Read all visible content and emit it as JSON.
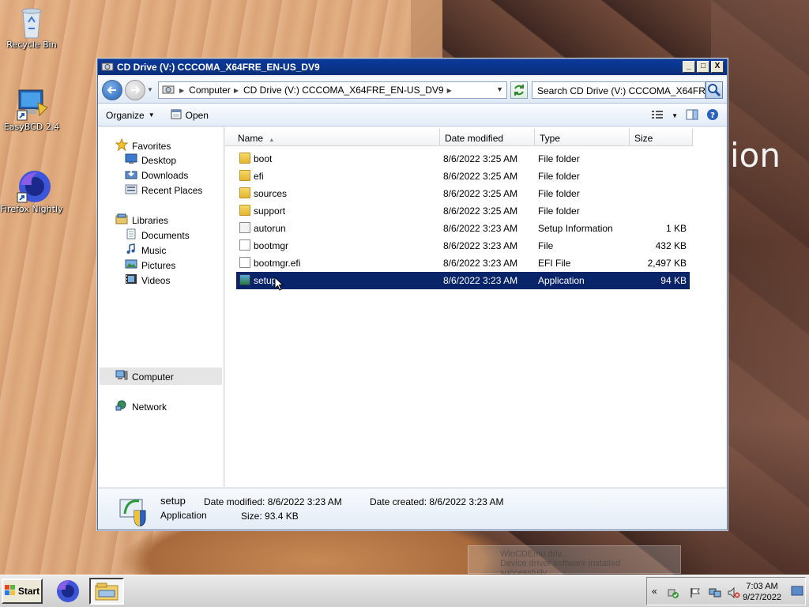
{
  "desktop": {
    "icons": [
      {
        "label": "Recycle Bin",
        "icon": "recycle-bin-icon"
      },
      {
        "label": "EasyBCD 2.4",
        "icon": "easybcd-icon"
      },
      {
        "label": "Firefox Nightly",
        "icon": "firefox-nightly-icon"
      }
    ],
    "wallpaper_text": "ion"
  },
  "window": {
    "title": "CD Drive (V:) CCCOMA_X64FRE_EN-US_DV9",
    "buttons": {
      "minimize": "_",
      "maximize": "□",
      "close": "X"
    },
    "address": {
      "crumbs": [
        "Computer",
        "CD Drive (V:) CCCOMA_X64FRE_EN-US_DV9"
      ]
    },
    "search_placeholder": "Search CD Drive (V:) CCCOMA_X64FR...",
    "commands": {
      "organize": "Organize",
      "open": "Open"
    },
    "nav": {
      "favorites": "Favorites",
      "desktop": "Desktop",
      "downloads": "Downloads",
      "recent": "Recent Places",
      "libraries": "Libraries",
      "documents": "Documents",
      "music": "Music",
      "pictures": "Pictures",
      "videos": "Videos",
      "computer": "Computer",
      "network": "Network"
    },
    "columns": {
      "name": "Name",
      "date": "Date modified",
      "type": "Type",
      "size": "Size"
    },
    "files": [
      {
        "name": "boot",
        "date": "8/6/2022 3:25 AM",
        "type": "File folder",
        "size": "",
        "kind": "folder"
      },
      {
        "name": "efi",
        "date": "8/6/2022 3:25 AM",
        "type": "File folder",
        "size": "",
        "kind": "folder"
      },
      {
        "name": "sources",
        "date": "8/6/2022 3:25 AM",
        "type": "File folder",
        "size": "",
        "kind": "folder"
      },
      {
        "name": "support",
        "date": "8/6/2022 3:25 AM",
        "type": "File folder",
        "size": "",
        "kind": "folder"
      },
      {
        "name": "autorun",
        "date": "8/6/2022 3:23 AM",
        "type": "Setup Information",
        "size": "1 KB",
        "kind": "inf"
      },
      {
        "name": "bootmgr",
        "date": "8/6/2022 3:23 AM",
        "type": "File",
        "size": "432 KB",
        "kind": "file"
      },
      {
        "name": "bootmgr.efi",
        "date": "8/6/2022 3:23 AM",
        "type": "EFI File",
        "size": "2,497 KB",
        "kind": "file"
      },
      {
        "name": "setup",
        "date": "8/6/2022 3:23 AM",
        "type": "Application",
        "size": "94 KB",
        "kind": "app",
        "selected": true
      }
    ],
    "details": {
      "name": "setup",
      "kind": "Application",
      "modified_label": "Date modified:",
      "modified": "8/6/2022 3:23 AM",
      "created_label": "Date created:",
      "created": "8/6/2022 3:23 AM",
      "size_label": "Size:",
      "size": "93.4 KB"
    }
  },
  "taskbar": {
    "start": "Start",
    "clock_time": "7:03 AM",
    "clock_date": "9/27/2022",
    "tray_toggle": "«"
  },
  "toast": {
    "title": "WinCDEmu driv...",
    "text": "Device driver software installed successfully"
  }
}
